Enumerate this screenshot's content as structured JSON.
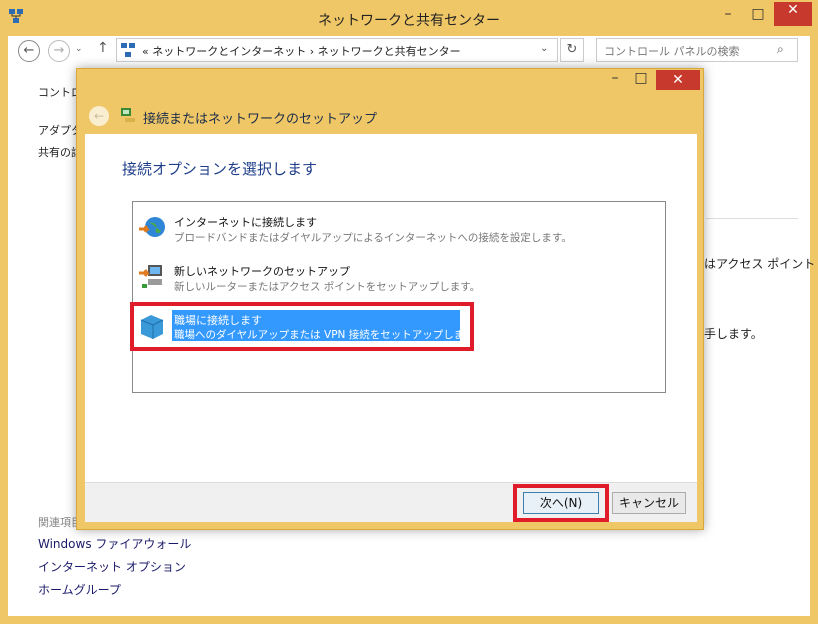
{
  "bg_window": {
    "title": "ネットワークと共有センター",
    "min": "–",
    "max": "□",
    "close": "✕",
    "nav": {
      "back": "←",
      "forward": "→",
      "recent": "⌄",
      "up": "↑"
    },
    "address": {
      "text": "«  ネットワークとインターネット  ›  ネットワークと共有センター",
      "dropdown": "⌄",
      "refresh": "↻"
    },
    "search": {
      "placeholder": "コントロール パネルの検索",
      "icon": "⌕"
    },
    "sidebar": [
      "コントロー",
      "アダプター",
      "共有の詳"
    ],
    "related_heading": "関連項目",
    "related_links": [
      "Windows ファイアウォール",
      "インターネット オプション",
      "ホームグループ"
    ],
    "right_fragments": [
      "はアクセス ポイント",
      "手します。"
    ]
  },
  "dialog": {
    "min": "–",
    "max": "□",
    "close": "✕",
    "back": "←",
    "title": "接続またはネットワークのセットアップ",
    "heading": "接続オプションを選択します",
    "options": [
      {
        "icon": "globe-internet-icon",
        "title": "インターネットに接続します",
        "desc": "ブロードバンドまたはダイヤルアップによるインターネットへの接続を設定します。",
        "selected": false
      },
      {
        "icon": "network-setup-icon",
        "title": "新しいネットワークのセットアップ",
        "desc": "新しいルーターまたはアクセス ポイントをセットアップします。",
        "selected": false
      },
      {
        "icon": "workplace-vpn-icon",
        "title": "職場に接続します",
        "desc": "職場へのダイヤルアップまたは VPN 接続をセットアップします。",
        "selected": true
      }
    ],
    "buttons": {
      "next": "次へ(N)",
      "cancel": "キャンセル"
    }
  },
  "colors": {
    "accent": "#f0c766",
    "selection": "#3399ff",
    "highlight": "#e01c2b",
    "close": "#c7392c"
  }
}
